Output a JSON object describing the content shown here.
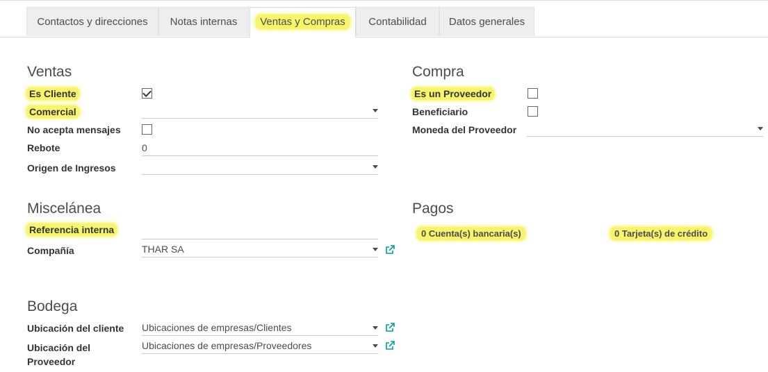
{
  "tabs": [
    {
      "label": "Contactos y direcciones"
    },
    {
      "label": "Notas internas"
    },
    {
      "label": "Ventas y Compras"
    },
    {
      "label": "Contabilidad"
    },
    {
      "label": "Datos generales"
    }
  ],
  "ventas": {
    "title": "Ventas",
    "es_cliente": {
      "label": "Es Cliente",
      "checked": true
    },
    "comercial": {
      "label": "Comercial",
      "value": ""
    },
    "no_acepta": {
      "label": "No acepta mensajes",
      "checked": false
    },
    "rebote": {
      "label": "Rebote",
      "value": "0"
    },
    "origen": {
      "label": "Origen de Ingresos",
      "value": ""
    }
  },
  "compra": {
    "title": "Compra",
    "es_proveedor": {
      "label": "Es un Proveedor",
      "checked": false
    },
    "beneficiario": {
      "label": "Beneficiario",
      "checked": false
    },
    "moneda": {
      "label": "Moneda del Proveedor",
      "value": ""
    }
  },
  "misc": {
    "title": "Miscelánea",
    "referencia": {
      "label": "Referencia interna",
      "value": ""
    },
    "compania": {
      "label": "Compañía",
      "value": "THAR SA"
    }
  },
  "pagos": {
    "title": "Pagos",
    "cuentas": "0 Cuenta(s) bancaria(s)",
    "tarjetas": "0 Tarjeta(s) de crédito"
  },
  "bodega": {
    "title": "Bodega",
    "ubic_cliente": {
      "label": "Ubicación del cliente",
      "value": "Ubicaciones de empresas/Clientes"
    },
    "ubic_proveedor": {
      "label_line1": "Ubicación del",
      "label_line2": "Proveedor",
      "value": "Ubicaciones de empresas/Proveedores"
    }
  },
  "colors": {
    "highlight": "#f7f56b",
    "link_icon": "#00a09d",
    "text": "#4c4c4c"
  }
}
